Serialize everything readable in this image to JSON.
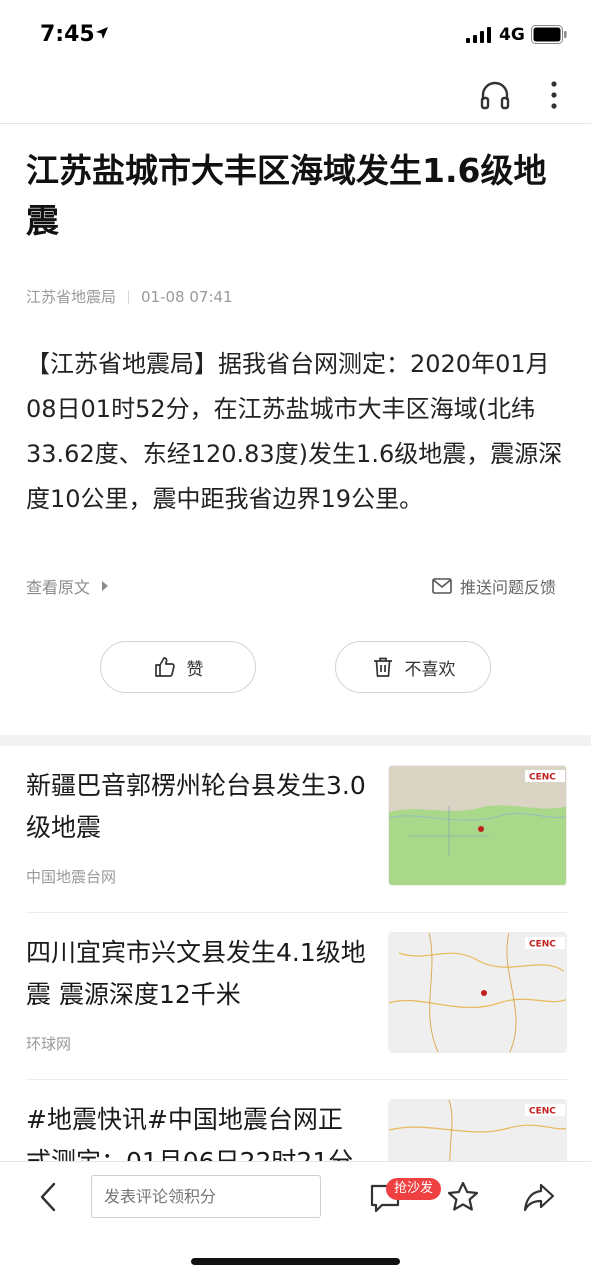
{
  "status_bar": {
    "time": "7:45",
    "network": "4G"
  },
  "article": {
    "title": "江苏盐城市大丰区海域发生1.6级地震",
    "source": "江苏省地震局",
    "datetime": "01-08 07:41",
    "body": "【江苏省地震局】据我省台网测定：2020年01月08日01时52分，在江苏盐城市大丰区海域(北纬33.62度、东经120.83度)发生1.6级地震，震源深度10公里，震中距我省边界19公里。",
    "view_original": "查看原文",
    "feedback": "推送问题反馈"
  },
  "reactions": {
    "like": "赞",
    "dislike": "不喜欢"
  },
  "related": [
    {
      "title": "新疆巴音郭楞州轮台县发生3.0级地震",
      "source": "中国地震台网",
      "thumb_label": "CENC"
    },
    {
      "title": "四川宜宾市兴文县发生4.1级地震 震源深度12千米",
      "source": "环球网",
      "thumb_label": "CENC"
    },
    {
      "title": "#地震快讯#中国地震台网正式测定：01月06日22时21分",
      "source": "",
      "thumb_label": "CENC"
    }
  ],
  "bottom_bar": {
    "comment_placeholder": "发表评论领积分",
    "sofa_badge": "抢沙发"
  },
  "colors": {
    "accent_red": "#f04142",
    "map_green": "#a9d88a",
    "map_gray": "#eeeeee"
  }
}
